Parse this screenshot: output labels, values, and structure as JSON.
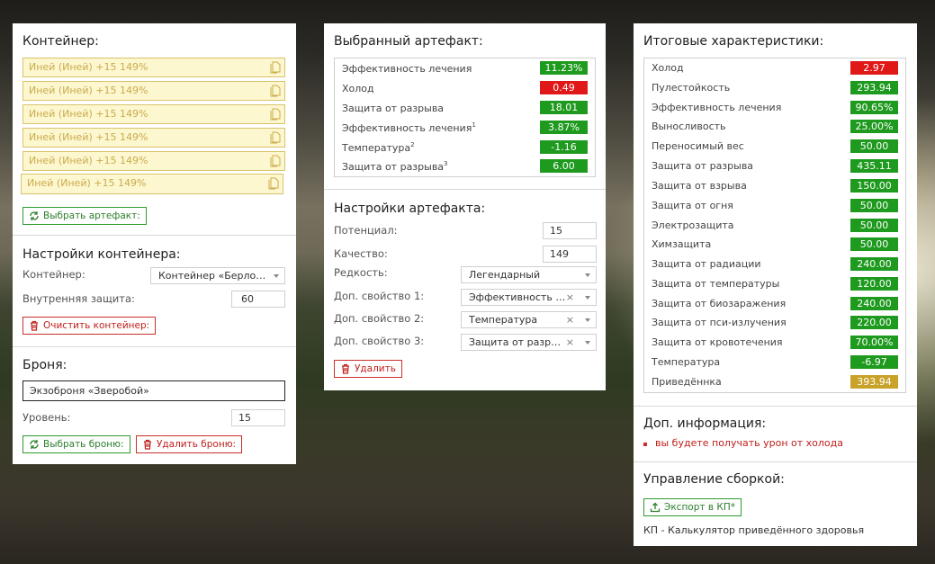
{
  "container_panel": {
    "title": "Контейнер:",
    "slots": [
      "Иней (Иней) +15 149%",
      "Иней (Иней) +15 149%",
      "Иней (Иней) +15 149%",
      "Иней (Иней) +15 149%",
      "Иней (Иней) +15 149%",
      "Иней (Иней) +15 149%"
    ],
    "slot_icon": "copy-icon",
    "select_artifact_label": "Выбрать артефакт:",
    "settings_title": "Настройки контейнера:",
    "container_label": "Контейнер:",
    "container_value": "Контейнер «Берлога…",
    "inner_protection_label": "Внутренняя защита:",
    "inner_protection_value": "60",
    "clear_container_label": "Очистить контейнер:",
    "armor_title": "Броня:",
    "armor_value": "Экзоброня «Зверобой»",
    "level_label": "Уровень:",
    "level_value": "15",
    "select_armor_label": "Выбрать броню:",
    "delete_armor_label": "Удалить броню:"
  },
  "artifact_panel": {
    "title": "Выбранный артефакт:",
    "stats": [
      {
        "name": "Эффективность лечения",
        "sup": "",
        "value": "11.23%",
        "color": "#1e9a1e"
      },
      {
        "name": "Холод",
        "sup": "",
        "value": "0.49",
        "color": "#e01818"
      },
      {
        "name": "Защита от разрыва",
        "sup": "",
        "value": "18.01",
        "color": "#1e9a1e"
      },
      {
        "name": "Эффективность лечения",
        "sup": "1",
        "value": "3.87%",
        "color": "#1e9a1e"
      },
      {
        "name": "Температура",
        "sup": "2",
        "value": "-1.16",
        "color": "#1e9a1e"
      },
      {
        "name": "Защита от разрыва",
        "sup": "3",
        "value": "6.00",
        "color": "#1e9a1e"
      }
    ],
    "settings_title": "Настройки артефакта:",
    "potential_label": "Потенциал:",
    "potential_value": "15",
    "quality_label": "Качество:",
    "quality_value": "149",
    "rarity_label": "Редкость:",
    "rarity_value": "Легендарный",
    "prop1_label": "Доп. свойство 1:",
    "prop1_value": "Эффективность ле…",
    "prop2_label": "Доп. свойство 2:",
    "prop2_value": "Температура",
    "prop3_label": "Доп. свойство 3:",
    "prop3_value": "Защита от разрыва",
    "clear_symbol": "×",
    "delete_label": "Удалить"
  },
  "totals_panel": {
    "title": "Итоговые характеристики:",
    "stats": [
      {
        "name": "Холод",
        "value": "2.97",
        "color": "#e01818"
      },
      {
        "name": "Пулестойкость",
        "value": "293.94",
        "color": "#1e9a1e"
      },
      {
        "name": "Эффективность лечения",
        "value": "90.65%",
        "color": "#1e9a1e"
      },
      {
        "name": "Выносливость",
        "value": "25.00%",
        "color": "#1e9a1e"
      },
      {
        "name": "Переносимый вес",
        "value": "50.00",
        "color": "#1e9a1e"
      },
      {
        "name": "Защита от разрыва",
        "value": "435.11",
        "color": "#1e9a1e"
      },
      {
        "name": "Защита от взрыва",
        "value": "150.00",
        "color": "#1e9a1e"
      },
      {
        "name": "Защита от огня",
        "value": "50.00",
        "color": "#1e9a1e"
      },
      {
        "name": "Электрозащита",
        "value": "50.00",
        "color": "#1e9a1e"
      },
      {
        "name": "Химзащита",
        "value": "50.00",
        "color": "#1e9a1e"
      },
      {
        "name": "Защита от радиации",
        "value": "240.00",
        "color": "#1e9a1e"
      },
      {
        "name": "Защита от температуры",
        "value": "120.00",
        "color": "#1e9a1e"
      },
      {
        "name": "Защита от биозаражения",
        "value": "240.00",
        "color": "#1e9a1e"
      },
      {
        "name": "Защита от пси-излучения",
        "value": "220.00",
        "color": "#1e9a1e"
      },
      {
        "name": "Защита от кровотечения",
        "value": "70.00%",
        "color": "#1e9a1e"
      },
      {
        "name": "Температура",
        "value": "-6.97",
        "color": "#1e9a1e"
      },
      {
        "name": "Приведённка",
        "value": "393.94",
        "color": "#c9a22a"
      }
    ],
    "info_title": "Доп. информация:",
    "warning": "вы будете получать урон от холода",
    "build_title": "Управление сборкой:",
    "export_label": "Экспорт в КП*",
    "footnote": "КП - Калькулятор приведённого здоровья"
  }
}
